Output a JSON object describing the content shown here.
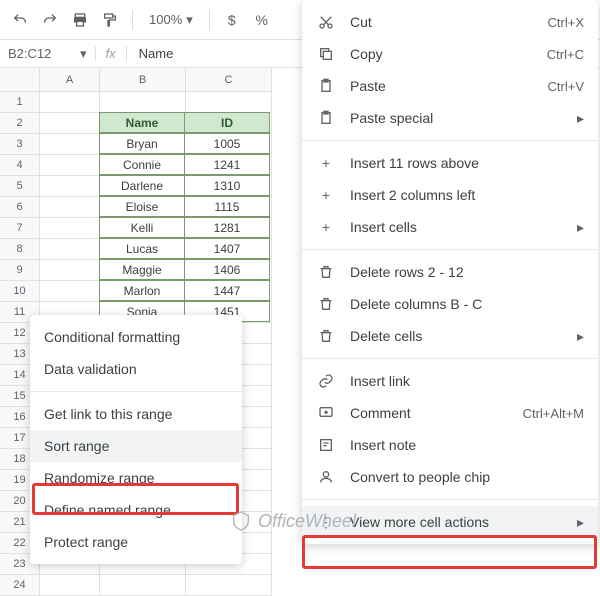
{
  "toolbar": {
    "zoom": "100%",
    "currency": "$",
    "percent": "%"
  },
  "namebox": {
    "range": "B2:C12",
    "fx_content": "Name"
  },
  "columns": [
    "A",
    "B",
    "C"
  ],
  "rows": [
    "1",
    "2",
    "3",
    "4",
    "5",
    "6",
    "7",
    "8",
    "9",
    "10",
    "11",
    "12",
    "13",
    "14",
    "15",
    "16",
    "17",
    "18",
    "19",
    "20",
    "21",
    "22",
    "23",
    "24"
  ],
  "table": {
    "headers": [
      "Name",
      "ID"
    ],
    "rows": [
      {
        "name": "Bryan",
        "id": "1005"
      },
      {
        "name": "Connie",
        "id": "1241"
      },
      {
        "name": "Darlene",
        "id": "1310"
      },
      {
        "name": "Eloise",
        "id": "1115"
      },
      {
        "name": "Kelli",
        "id": "1281"
      },
      {
        "name": "Lucas",
        "id": "1407"
      },
      {
        "name": "Maggie",
        "id": "1406"
      },
      {
        "name": "Marlon",
        "id": "1447"
      },
      {
        "name": "Sonja",
        "id": "1451"
      }
    ]
  },
  "menu_main": {
    "cut": {
      "label": "Cut",
      "shortcut": "Ctrl+X"
    },
    "copy": {
      "label": "Copy",
      "shortcut": "Ctrl+C"
    },
    "paste": {
      "label": "Paste",
      "shortcut": "Ctrl+V"
    },
    "paste_special": {
      "label": "Paste special"
    },
    "insert_rows": {
      "label": "Insert 11 rows above"
    },
    "insert_cols": {
      "label": "Insert 2 columns left"
    },
    "insert_cells": {
      "label": "Insert cells"
    },
    "delete_rows": {
      "label": "Delete rows 2 - 12"
    },
    "delete_cols": {
      "label": "Delete columns B - C"
    },
    "delete_cells": {
      "label": "Delete cells"
    },
    "insert_link": {
      "label": "Insert link"
    },
    "comment": {
      "label": "Comment",
      "shortcut": "Ctrl+Alt+M"
    },
    "insert_note": {
      "label": "Insert note"
    },
    "people_chip": {
      "label": "Convert to people chip"
    },
    "more": {
      "label": "View more cell actions"
    }
  },
  "menu_sub": {
    "cond_format": {
      "label": "Conditional formatting"
    },
    "data_validation": {
      "label": "Data validation"
    },
    "get_link": {
      "label": "Get link to this range"
    },
    "sort_range": {
      "label": "Sort range"
    },
    "randomize": {
      "label": "Randomize range"
    },
    "named_range": {
      "label": "Define named range"
    },
    "protect": {
      "label": "Protect range"
    }
  },
  "watermark": "OfficeWheel"
}
